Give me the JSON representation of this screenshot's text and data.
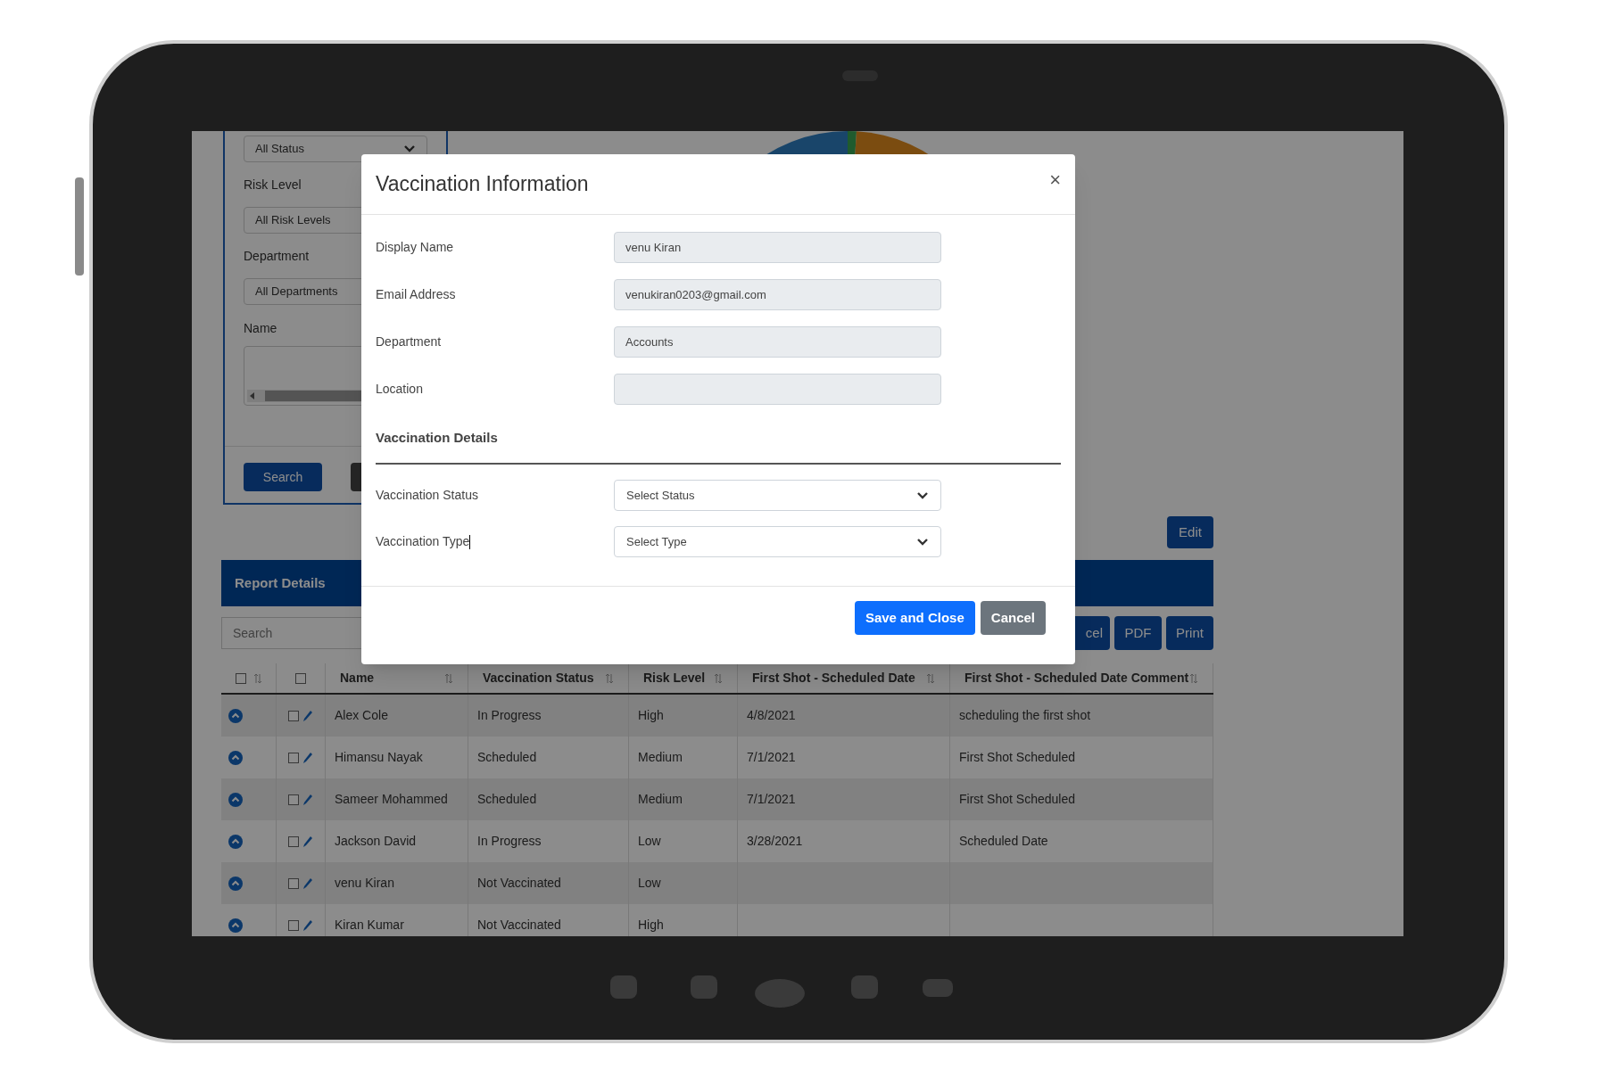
{
  "filters": {
    "selects": [
      {
        "value": "All Status"
      },
      {
        "label": "Risk Level",
        "value": "All Risk Levels"
      },
      {
        "label": "Department",
        "value": "All Departments"
      }
    ],
    "name_label": "Name",
    "search_button": "Search"
  },
  "edit_button": "Edit",
  "report": {
    "title": "Report Details",
    "search": {
      "placeholder": "Search"
    },
    "export_buttons": [
      "cel",
      "PDF",
      "Print"
    ],
    "header_checkboxes": [
      {
        "checked": false
      },
      {
        "checked": false
      }
    ],
    "columns": [
      "Name",
      "Vaccination Status",
      "Risk Level",
      "First Shot - Scheduled Date",
      "First Shot - Scheduled Date Comment"
    ],
    "rows": [
      {
        "checked": false,
        "cells": [
          "Alex Cole",
          "In Progress",
          "High",
          "4/8/2021",
          "scheduling the first shot"
        ]
      },
      {
        "checked": false,
        "cells": [
          "Himansu Nayak",
          "Scheduled",
          "Medium",
          "7/1/2021",
          "First Shot Scheduled"
        ]
      },
      {
        "checked": false,
        "cells": [
          "Sameer Mohammed",
          "Scheduled",
          "Medium",
          "7/1/2021",
          "First Shot Scheduled"
        ]
      },
      {
        "checked": false,
        "cells": [
          "Jackson David",
          "In Progress",
          "Low",
          "3/28/2021",
          "Scheduled Date"
        ]
      },
      {
        "checked": false,
        "cells": [
          "venu Kiran",
          "Not Vaccinated",
          "Low",
          "",
          ""
        ]
      },
      {
        "checked": false,
        "cells": [
          "Kiran Kumar",
          "Not Vaccinated",
          "High",
          "",
          ""
        ]
      }
    ]
  },
  "modal": {
    "title": "Vaccination Information",
    "close": "×",
    "fields": [
      {
        "kind": "text",
        "label": "Display Name",
        "value": "venu Kiran"
      },
      {
        "kind": "text",
        "label": "Email Address",
        "value": "venukiran0203@gmail.com"
      },
      {
        "kind": "text",
        "label": "Department",
        "value": "Accounts"
      },
      {
        "kind": "text",
        "label": "Location"
      }
    ],
    "section": "Vaccination Details",
    "selects": [
      {
        "kind": "select",
        "label": "Vaccination Status",
        "value": "Select Status",
        "focused": false
      },
      {
        "kind": "select",
        "label": "Vaccination Type",
        "value": "Select Type",
        "focused": true
      }
    ],
    "buttons": [
      {
        "kind": "primary",
        "label": "Save and Close"
      },
      {
        "kind": "secondary",
        "label": "Cancel"
      }
    ]
  }
}
